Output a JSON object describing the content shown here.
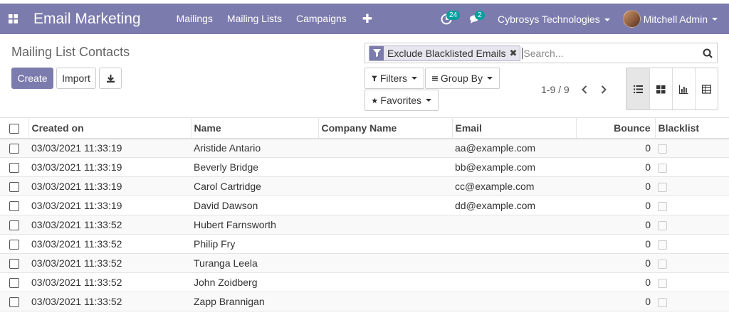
{
  "navbar": {
    "brand": "Email Marketing",
    "menu": [
      "Mailings",
      "Mailing Lists",
      "Campaigns"
    ],
    "activity_count": "24",
    "message_count": "2",
    "company": "Cybrosys Technologies",
    "user": "Mitchell Admin",
    "colors": {
      "primary": "#7c7bad",
      "badge": "#00a09d"
    }
  },
  "control_panel": {
    "title": "Mailing List Contacts",
    "create_label": "Create",
    "import_label": "Import",
    "facet_label": "Exclude Blacklisted Emails",
    "search_placeholder": "Search...",
    "filters_label": "Filters",
    "groupby_label": "Group By",
    "favorites_label": "Favorites",
    "pager": "1-9 / 9"
  },
  "table": {
    "headers": {
      "created_on": "Created on",
      "name": "Name",
      "company": "Company Name",
      "email": "Email",
      "bounce": "Bounce",
      "blacklist": "Blacklist"
    },
    "rows": [
      {
        "created_on": "03/03/2021 11:33:19",
        "name": "Aristide Antario",
        "company": "",
        "email": "aa@example.com",
        "bounce": "0"
      },
      {
        "created_on": "03/03/2021 11:33:19",
        "name": "Beverly Bridge",
        "company": "",
        "email": "bb@example.com",
        "bounce": "0"
      },
      {
        "created_on": "03/03/2021 11:33:19",
        "name": "Carol Cartridge",
        "company": "",
        "email": "cc@example.com",
        "bounce": "0"
      },
      {
        "created_on": "03/03/2021 11:33:19",
        "name": "David Dawson",
        "company": "",
        "email": "dd@example.com",
        "bounce": "0"
      },
      {
        "created_on": "03/03/2021 11:33:52",
        "name": "Hubert Farnsworth",
        "company": "",
        "email": "",
        "bounce": "0"
      },
      {
        "created_on": "03/03/2021 11:33:52",
        "name": "Philip Fry",
        "company": "",
        "email": "",
        "bounce": "0"
      },
      {
        "created_on": "03/03/2021 11:33:52",
        "name": "Turanga Leela",
        "company": "",
        "email": "",
        "bounce": "0"
      },
      {
        "created_on": "03/03/2021 11:33:52",
        "name": "John Zoidberg",
        "company": "",
        "email": "",
        "bounce": "0"
      },
      {
        "created_on": "03/03/2021 11:33:52",
        "name": "Zapp Brannigan",
        "company": "",
        "email": "",
        "bounce": "0"
      }
    ]
  }
}
